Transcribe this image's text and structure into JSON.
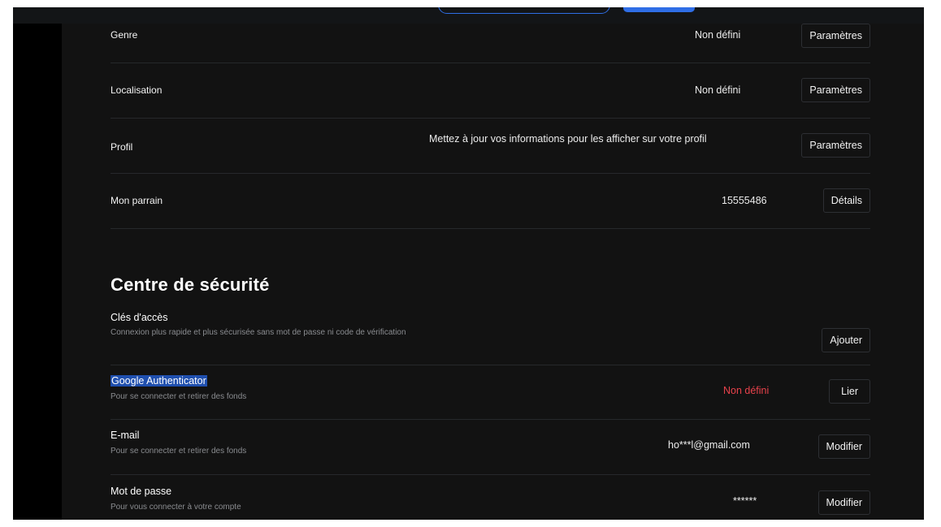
{
  "profile_rows": [
    {
      "label": "Genre",
      "value": "Non défini",
      "button": "Paramètres"
    },
    {
      "label": "Localisation",
      "value": "Non défini",
      "button": "Paramètres"
    },
    {
      "label": "Profil",
      "value": "Mettez à jour vos informations pour les afficher sur votre profil",
      "button": "Paramètres"
    },
    {
      "label": "Mon parrain",
      "value": "15555486",
      "button": "Détails"
    }
  ],
  "security": {
    "title": "Centre de sécurité",
    "items": [
      {
        "title": "Clés d'accès",
        "description": "Connexion plus rapide et plus sécurisée sans mot de passe ni code de vérification",
        "value": "",
        "button": "Ajouter"
      },
      {
        "title": "Google Authenticator",
        "description": "Pour se connecter et retirer des fonds",
        "value": "Non défini",
        "button": "Lier"
      },
      {
        "title": "E-mail",
        "description": "Pour se connecter et retirer des fonds",
        "value": "ho***l@gmail.com",
        "button": "Modifier"
      },
      {
        "title": "Mot de passe",
        "description": "Pour vous connecter à votre compte",
        "value": "******",
        "button": "Modifier"
      }
    ]
  },
  "colors": {
    "accent": "#2f6ee6",
    "warning": "#e8424b",
    "background": "#121212"
  }
}
